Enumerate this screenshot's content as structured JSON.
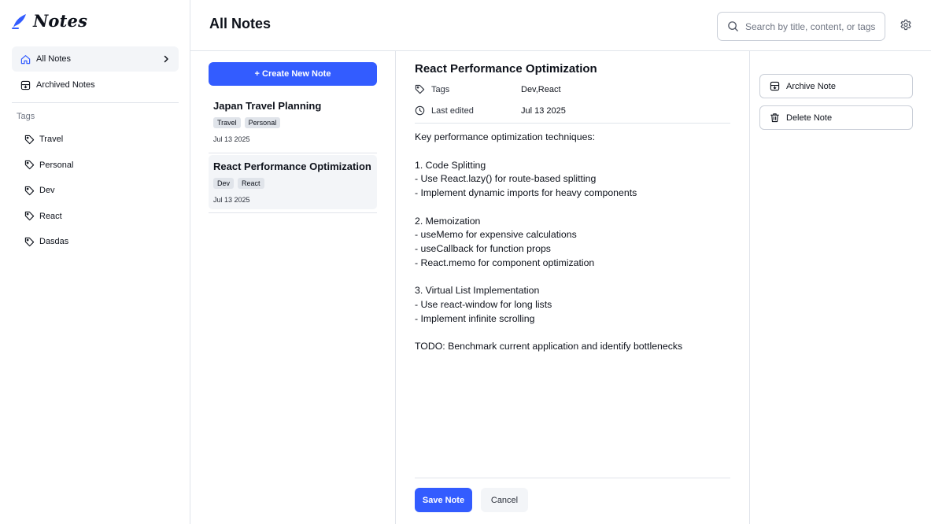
{
  "app": {
    "logo_text": "Notes",
    "brand_color": "#335cff"
  },
  "sidebar": {
    "nav": [
      {
        "label": "All Notes",
        "icon": "home-icon",
        "active": true
      },
      {
        "label": "Archived Notes",
        "icon": "archive-icon",
        "active": false
      }
    ],
    "tags_title": "Tags",
    "tags": [
      "Travel",
      "Personal",
      "Dev",
      "React",
      "Dasdas"
    ]
  },
  "header": {
    "title": "All Notes",
    "search_placeholder": "Search by title, content, or tags..."
  },
  "list": {
    "create_label": "+ Create New Note",
    "notes": [
      {
        "title": "Japan Travel Planning",
        "tags": [
          "Travel",
          "Personal"
        ],
        "date": "Jul 13 2025",
        "selected": false
      },
      {
        "title": "React Performance Optimization",
        "tags": [
          "Dev",
          "React"
        ],
        "date": "Jul 13 2025",
        "selected": true
      }
    ]
  },
  "editor": {
    "title": "React Performance Optimization",
    "tags_label": "Tags",
    "tags_value": "Dev,React",
    "edited_label": "Last edited",
    "edited_value": "Jul 13 2025",
    "body": "Key performance optimization techniques:\n\n1. Code Splitting\n- Use React.lazy() for route-based splitting\n- Implement dynamic imports for heavy components\n\n2. Memoization\n- useMemo for expensive calculations\n- useCallback for function props\n- React.memo for component optimization\n\n3. Virtual List Implementation\n- Use react-window for long lists\n- Implement infinite scrolling\n\nTODO: Benchmark current application and identify bottlenecks",
    "save_label": "Save Note",
    "cancel_label": "Cancel"
  },
  "actions": {
    "archive_label": "Archive Note",
    "delete_label": "Delete Note"
  }
}
